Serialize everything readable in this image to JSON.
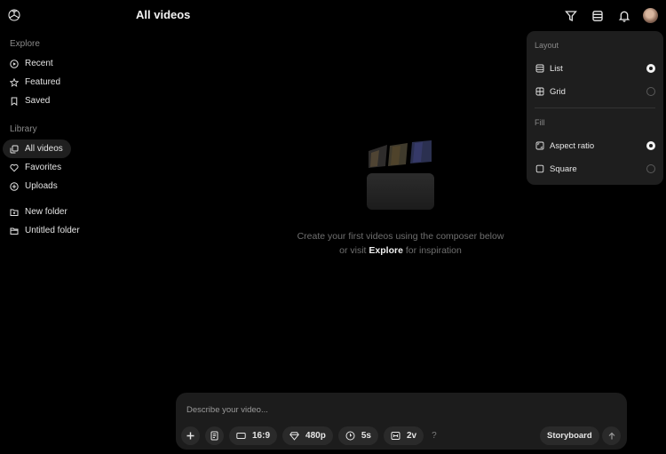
{
  "header": {
    "title": "All videos"
  },
  "sidebar": {
    "explore_title": "Explore",
    "explore_items": [
      {
        "label": "Recent",
        "icon": "play-circle-icon"
      },
      {
        "label": "Featured",
        "icon": "star-icon"
      },
      {
        "label": "Saved",
        "icon": "bookmark-icon"
      }
    ],
    "library_title": "Library",
    "library_items": [
      {
        "label": "All videos",
        "icon": "videos-icon",
        "active": true
      },
      {
        "label": "Favorites",
        "icon": "heart-icon"
      },
      {
        "label": "Uploads",
        "icon": "plus-circle-icon"
      }
    ],
    "folder_items": [
      {
        "label": "New folder",
        "icon": "new-folder-icon"
      },
      {
        "label": "Untitled folder",
        "icon": "folder-icon"
      }
    ]
  },
  "empty_state": {
    "line1": "Create your first videos using the composer below",
    "line2_prefix": "or visit",
    "link": "Explore",
    "line2_suffix": "for inspiration"
  },
  "view_menu": {
    "layout_title": "Layout",
    "layout_options": [
      {
        "label": "List",
        "icon": "list-icon",
        "selected": true
      },
      {
        "label": "Grid",
        "icon": "grid-icon",
        "selected": false
      }
    ],
    "fill_title": "Fill",
    "fill_options": [
      {
        "label": "Aspect ratio",
        "icon": "aspect-ratio-icon",
        "selected": true
      },
      {
        "label": "Square",
        "icon": "square-icon",
        "selected": false
      }
    ]
  },
  "composer": {
    "placeholder": "Describe your video...",
    "aspect": "16:9",
    "resolution": "480p",
    "duration": "5s",
    "variations": "2v",
    "help": "?",
    "storyboard": "Storyboard"
  },
  "colors": {
    "background": "#000000",
    "panel": "#1e1e1e",
    "chip": "#2a2a2a"
  }
}
